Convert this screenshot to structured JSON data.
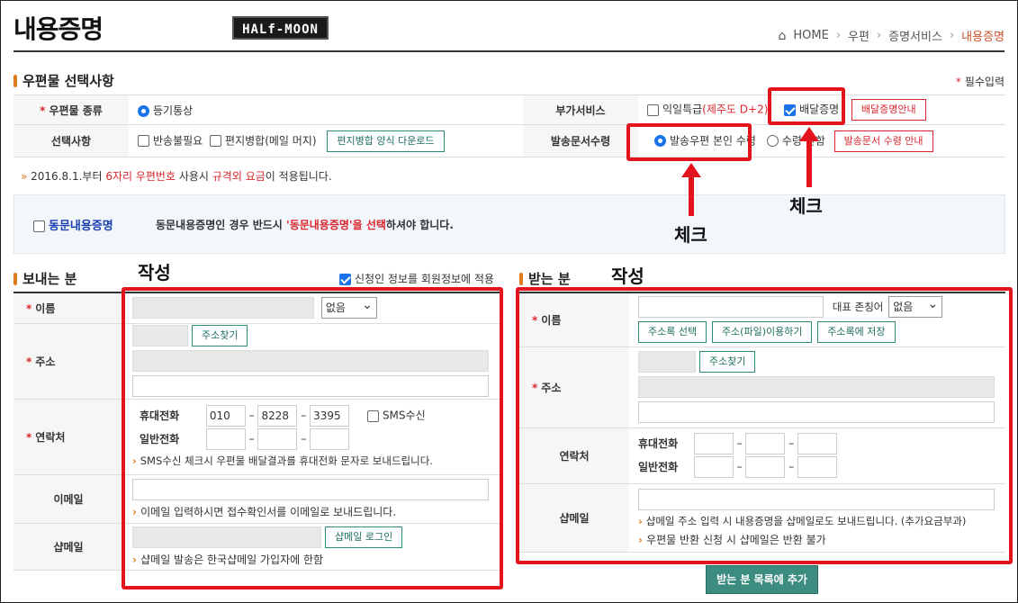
{
  "header": {
    "title": "내용증명",
    "logo_text": "HALf-MOON",
    "breadcrumb": [
      "HOME",
      "우편",
      "증명서비스",
      "내용증명"
    ]
  },
  "options_section": {
    "title": "우편물 선택사항",
    "required_note": "필수입력",
    "mail_type_label": "우편물 종류",
    "mail_type_value": "등기통상",
    "extra_service_label": "부가서비스",
    "next_day_label": "익일특급",
    "next_day_note": "(제주도 D+2)",
    "delivery_proof_label": "배달증명",
    "delivery_proof_guide_btn": "배달증명안내",
    "options_label": "선택사항",
    "no_return_label": "반송불필요",
    "merge_label": "편지병합(메일 머지)",
    "merge_download_btn": "편지병합 양식 다운로드",
    "receipt_label": "발송문서수령",
    "receipt_opt1": "발송우편 본인 수령",
    "receipt_opt2": "수령 안함",
    "receipt_guide_btn": "발송문서 수령 안내"
  },
  "notice": {
    "prefix": "2016.8.1.부터 ",
    "hl1": "6자리 우편번호",
    "mid": " 사용시 ",
    "hl2": "규격외 요금",
    "suffix": "이 적용됩니다."
  },
  "same_doc": {
    "label": "동문내용증명",
    "desc_prefix": "동문내용증명인 경우 반드시 ",
    "desc_hl": "'동문내용증명'을 선택",
    "desc_suffix": "하셔야 합니다."
  },
  "sender": {
    "title": "보내는 분",
    "use_member_info": "신청인 정보를 회원정보에 적용",
    "name_label": "이름",
    "honorific_value": "없음",
    "address_label": "주소",
    "address_search_btn": "주소찾기",
    "contact_label": "연락처",
    "mobile_label": "휴대전화",
    "mobile": [
      "010",
      "8228",
      "3395"
    ],
    "sms_label": "SMS수신",
    "phone_label": "일반전화",
    "sms_note": "SMS수신 체크시 우편물 배달결과를 휴대전화 문자로 보내드립니다.",
    "email_label": "이메일",
    "email_note": "이메일 입력하시면 접수확인서를 이메일로 보내드립니다.",
    "shopmail_label": "샵메일",
    "shopmail_login_btn": "샵메일 로그인",
    "shopmail_note": "샵메일 발송은 한국샵메일 가입자에 한함"
  },
  "receiver": {
    "title": "받는 분",
    "name_label": "이름",
    "honorific_label": "대표 존칭어",
    "honorific_value": "없음",
    "addrbook_select_btn": "주소록 선택",
    "addr_file_btn": "주소(파일)이용하기",
    "addrbook_save_btn": "주소록에 저장",
    "address_label": "주소",
    "address_search_btn": "주소찾기",
    "contact_label": "연락처",
    "mobile_label": "휴대전화",
    "phone_label": "일반전화",
    "shopmail_label": "샵메일",
    "shopmail_note1": "샵메일 주소 입력 시 내용증명을 샵메일로도 보내드립니다. (추가요금부과)",
    "shopmail_note2": "우편물 반환 신청 시 샵메일은 반환 불가",
    "add_btn": "받는 분 목록에 추가"
  },
  "annotations": {
    "check1": "체크",
    "check2": "체크",
    "write1": "작성",
    "write2": "작성"
  },
  "colors": {
    "accent_orange": "#e07a1f",
    "highlight_red": "#d9262d",
    "annotation_red": "#e4141e",
    "teal_button": "#2e8a7a"
  }
}
